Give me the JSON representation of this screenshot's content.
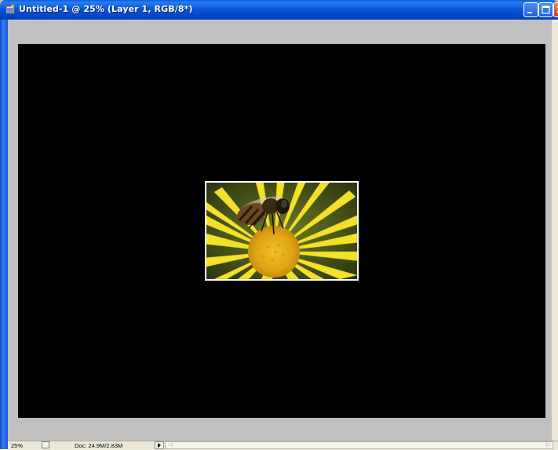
{
  "window": {
    "title": "Untitled-1 @ 25% (Layer 1, RGB/8*)",
    "app_icon": "photoshop-document-icon",
    "controls": [
      "minimize-icon",
      "maximize-icon",
      "close-icon"
    ]
  },
  "canvas": {
    "background_color": "#000000",
    "pasteboard_color": "#c0c0c0",
    "image_subject": "bee on yellow daisy flower"
  },
  "statusbar": {
    "zoom": "25%",
    "doc_info": "Doc: 24.9M/2.83M",
    "menu_arrow": "▶",
    "scroll_left": "◁",
    "scroll_right": "▷"
  }
}
